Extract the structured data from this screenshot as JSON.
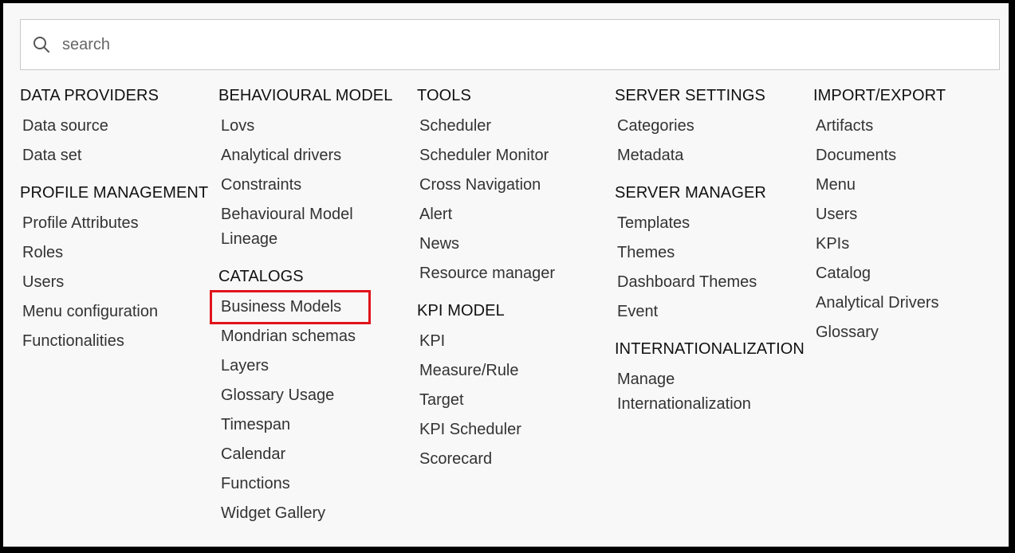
{
  "search": {
    "placeholder": "search",
    "icon": "search-icon"
  },
  "highlight_color": "#e0141c",
  "columns": [
    {
      "sections": [
        {
          "heading": "DATA PROVIDERS",
          "items": [
            "Data source",
            "Data set"
          ]
        },
        {
          "heading": "PROFILE MANAGEMENT",
          "items": [
            "Profile Attributes",
            "Roles",
            "Users",
            "Menu configuration",
            "Functionalities"
          ]
        }
      ]
    },
    {
      "sections": [
        {
          "heading": "BEHAVIOURAL MODEL",
          "items": [
            "Lovs",
            "Analytical drivers",
            "Constraints",
            "Behavioural Model Lineage"
          ]
        },
        {
          "heading": "CATALOGS",
          "items": [
            "Business Models",
            "Mondrian schemas",
            "Layers",
            "Glossary Usage",
            "Timespan",
            "Calendar",
            "Functions",
            "Widget Gallery"
          ]
        }
      ]
    },
    {
      "sections": [
        {
          "heading": "TOOLS",
          "items": [
            "Scheduler",
            "Scheduler Monitor",
            "Cross Navigation",
            "Alert",
            "News",
            "Resource manager"
          ]
        },
        {
          "heading": "KPI MODEL",
          "items": [
            "KPI",
            "Measure/Rule",
            "Target",
            "KPI Scheduler",
            "Scorecard"
          ]
        }
      ]
    },
    {
      "sections": [
        {
          "heading": "SERVER SETTINGS",
          "items": [
            "Categories",
            "Metadata"
          ]
        },
        {
          "heading": "SERVER MANAGER",
          "items": [
            "Templates",
            "Themes",
            "Dashboard Themes",
            "Event"
          ]
        },
        {
          "heading": "INTERNATIONALIZATION",
          "items": [
            "Manage Internationalization"
          ]
        }
      ]
    },
    {
      "sections": [
        {
          "heading": "IMPORT/EXPORT",
          "items": [
            "Artifacts",
            "Documents",
            "Menu",
            "Users",
            "KPIs",
            "Catalog",
            "Analytical Drivers",
            "Glossary"
          ]
        }
      ]
    }
  ]
}
